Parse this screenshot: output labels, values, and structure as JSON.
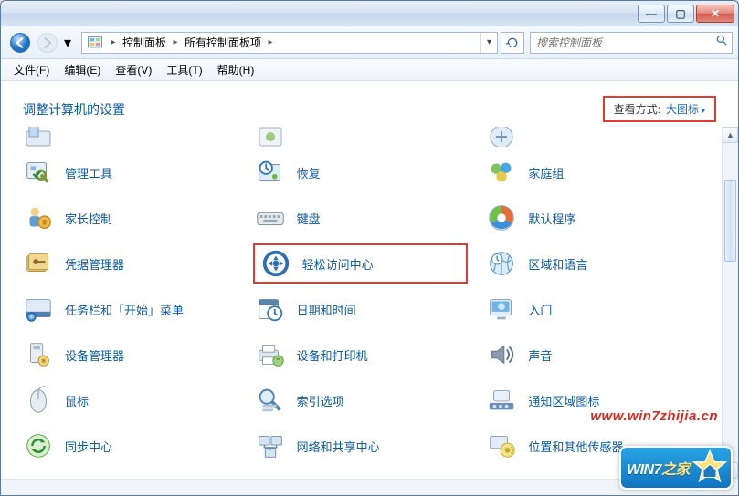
{
  "titlebar": {
    "min": "—",
    "max": "▢",
    "close": "✕"
  },
  "nav": {
    "root_icon": "control-panel",
    "crumb1": "控制面板",
    "crumb2": "所有控制面板项"
  },
  "refresh_icon": "refresh",
  "search": {
    "placeholder": "搜索控制面板",
    "icon": "search"
  },
  "menu": {
    "file": "文件(F)",
    "edit": "编辑(E)",
    "view": "查看(V)",
    "tools": "工具(T)",
    "help": "帮助(H)"
  },
  "header": {
    "title": "调整计算机的设置",
    "view_label": "查看方式:",
    "view_value": "大图标"
  },
  "items_row0": [
    {
      "label": "",
      "icon": "generic1"
    },
    {
      "label": "",
      "icon": "generic2"
    },
    {
      "label": "",
      "icon": "generic3"
    }
  ],
  "items": [
    {
      "label": "管理工具",
      "icon": "admin-tools"
    },
    {
      "label": "恢复",
      "icon": "recovery"
    },
    {
      "label": "家庭组",
      "icon": "homegroup"
    },
    {
      "label": "家长控制",
      "icon": "parental"
    },
    {
      "label": "键盘",
      "icon": "keyboard"
    },
    {
      "label": "默认程序",
      "icon": "default-programs"
    },
    {
      "label": "凭据管理器",
      "icon": "credential"
    },
    {
      "label": "轻松访问中心",
      "icon": "ease-access",
      "highlight": true
    },
    {
      "label": "区域和语言",
      "icon": "region"
    },
    {
      "label": "任务栏和「开始」菜单",
      "icon": "taskbar"
    },
    {
      "label": "日期和时间",
      "icon": "date-time"
    },
    {
      "label": "入门",
      "icon": "getting-started"
    },
    {
      "label": "设备管理器",
      "icon": "device-manager"
    },
    {
      "label": "设备和打印机",
      "icon": "devices-printers"
    },
    {
      "label": "声音",
      "icon": "sound"
    },
    {
      "label": "鼠标",
      "icon": "mouse"
    },
    {
      "label": "索引选项",
      "icon": "indexing"
    },
    {
      "label": "通知区域图标",
      "icon": "notification"
    },
    {
      "label": "同步中心",
      "icon": "sync-center"
    },
    {
      "label": "网络和共享中心",
      "icon": "network-sharing"
    },
    {
      "label": "位置和其他传感器",
      "icon": "location-sensors"
    }
  ],
  "watermark": {
    "url": "www.win7zhijia.cn",
    "badge_text": "WIN7",
    "badge_suffix": "之家"
  }
}
